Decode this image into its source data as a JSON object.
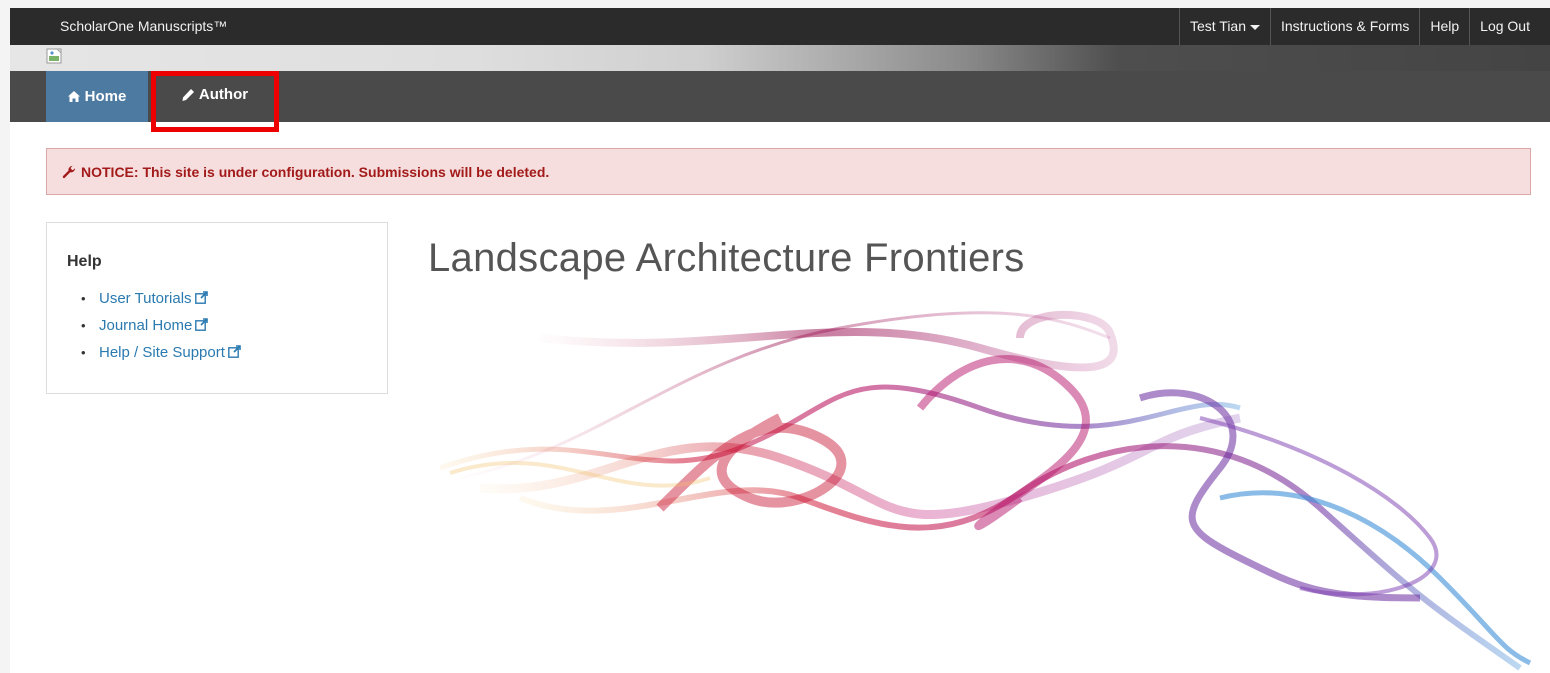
{
  "app": {
    "brand": "ScholarOne Manuscripts™"
  },
  "topnav": {
    "user": "Test Tian",
    "instructions": "Instructions & Forms",
    "help": "Help",
    "logout": "Log Out"
  },
  "nav": {
    "home": "Home",
    "author": "Author",
    "home_icon": "home-icon",
    "author_icon": "pencil-icon"
  },
  "notice": {
    "text": "NOTICE: This site is under configuration. Submissions will be deleted.",
    "icon": "wrench-icon"
  },
  "help_panel": {
    "title": "Help",
    "links": [
      {
        "label": "User Tutorials"
      },
      {
        "label": "Journal Home"
      },
      {
        "label": "Help / Site Support"
      }
    ]
  },
  "journal": {
    "title": "Landscape Architecture Frontiers"
  },
  "colors": {
    "topbar": "#2b2b2b",
    "navbar": "#4a4a4a",
    "home_active": "#4d7aa0",
    "highlight": "#ee0000",
    "notice_bg": "#f6dede",
    "notice_text": "#a31a1a",
    "link": "#2a7ab0"
  }
}
